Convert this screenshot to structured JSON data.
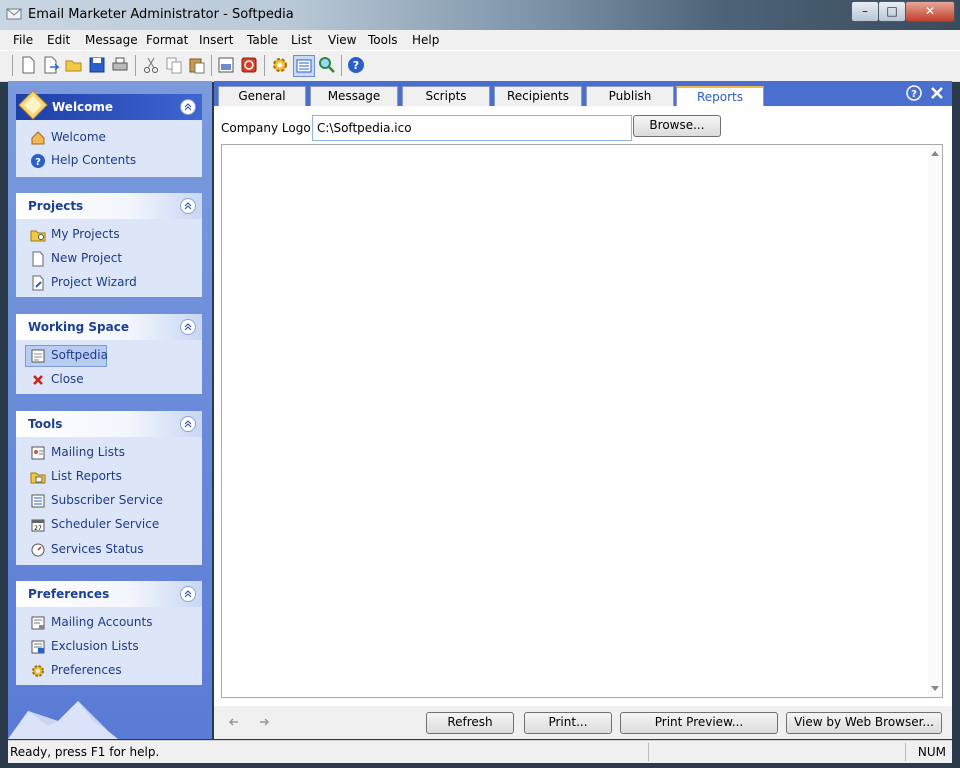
{
  "window": {
    "title": "Email Marketer Administrator - Softpedia"
  },
  "menu": [
    "File",
    "Edit",
    "Message",
    "Format",
    "Insert",
    "Table",
    "List",
    "View",
    "Tools",
    "Help"
  ],
  "toolbar": {
    "icons": [
      "new-icon",
      "open-icon",
      "folder-open-icon",
      "save-icon",
      "print-icon",
      "cut-icon",
      "copy-icon",
      "paste-icon",
      "import-icon",
      "stop-icon",
      "gear-icon",
      "list-view-icon",
      "search-icon",
      "help-icon"
    ]
  },
  "sidebar": {
    "welcome": {
      "title": "Welcome",
      "items": [
        "Welcome",
        "Help Contents"
      ]
    },
    "projects": {
      "title": "Projects",
      "items": [
        "My Projects",
        "New Project",
        "Project Wizard"
      ]
    },
    "working_space": {
      "title": "Working Space",
      "items": [
        "Softpedia",
        "Close"
      ]
    },
    "tools": {
      "title": "Tools",
      "items": [
        "Mailing Lists",
        "List Reports",
        "Subscriber Service",
        "Scheduler Service",
        "Services Status"
      ]
    },
    "preferences": {
      "title": "Preferences",
      "items": [
        "Mailing Accounts",
        "Exclusion Lists",
        "Preferences"
      ]
    }
  },
  "tabs": [
    "General",
    "Message",
    "Scripts",
    "Recipients",
    "Publish",
    "Reports"
  ],
  "active_tab": "Reports",
  "reports": {
    "logo_label": "Company Logo:",
    "logo_value": "C:\\Softpedia.ico",
    "browse_label": "Browse..."
  },
  "actions": {
    "refresh": "Refresh",
    "print": "Print...",
    "print_preview": "Print Preview...",
    "web_browser": "View by Web Browser..."
  },
  "status": {
    "text": "Ready, press F1 for help.",
    "num": "NUM"
  },
  "colors": {
    "accent": "#4a6fcf",
    "sidebar_text": "#1d3a8a",
    "active_tab_text": "#2a5fc9"
  }
}
